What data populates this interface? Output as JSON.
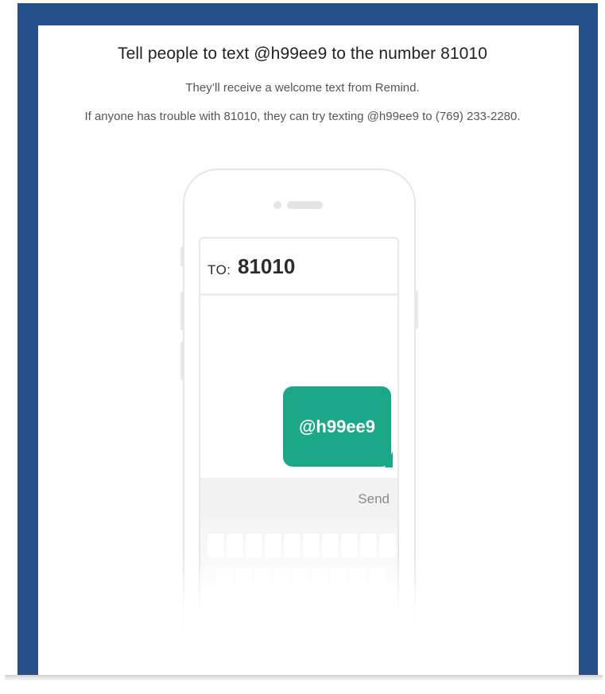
{
  "header": {
    "title": "Tell people to text @h99ee9 to the number 81010",
    "subtitle": "They’ll receive a welcome text from Remind.",
    "fallback": "If anyone has trouble with 81010, they can try texting @h99ee9 to (769) 233-2280."
  },
  "phone": {
    "to_label": "TO:",
    "to_number": "81010",
    "message": "@h99ee9",
    "send_label": "Send"
  },
  "colors": {
    "frame": "#26508a",
    "bubble": "#1ba888"
  }
}
